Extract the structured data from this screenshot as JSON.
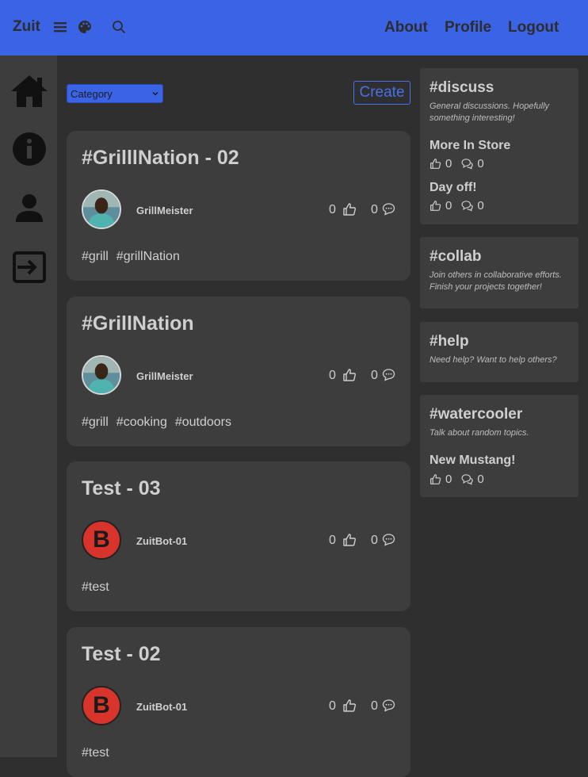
{
  "header": {
    "brand": "Zuit",
    "icons": [
      "menu-icon",
      "palette-icon",
      "search-icon"
    ],
    "nav": {
      "about": "About",
      "profile": "Profile",
      "logout": "Logout"
    },
    "accent": "#3b63e6"
  },
  "sidebar": {
    "icons": [
      "home-icon",
      "info-icon",
      "user-icon",
      "logout-icon"
    ]
  },
  "toolbar": {
    "category_value": "Category",
    "create_label": "Create"
  },
  "posts": [
    {
      "title": "#GrilllNation - 02",
      "author": "GrillMeister",
      "likes": "0",
      "comments": "0",
      "tags": [
        "#grill",
        "#grillNation"
      ]
    },
    {
      "title": "#GrillNation",
      "author": "GrillMeister",
      "likes": "0",
      "comments": "0",
      "tags": [
        "#grill",
        "#cooking",
        "#outdoors"
      ]
    },
    {
      "title": "Test - 03",
      "author": "ZuitBot-01",
      "avatar_letter": "B",
      "likes": "0",
      "comments": "0",
      "tags": [
        "#test"
      ]
    },
    {
      "title": "Test - 02",
      "author": "ZuitBot-01",
      "avatar_letter": "B",
      "likes": "0",
      "comments": "0",
      "tags": [
        "#test"
      ]
    }
  ],
  "channels": [
    {
      "name": "#discuss",
      "description": "General discussions. Hopefully something interesting!",
      "posts": [
        {
          "title": "More In Store",
          "likes": "0",
          "comments": "0"
        },
        {
          "title": "Day off!",
          "likes": "0",
          "comments": "0"
        }
      ]
    },
    {
      "name": "#collab",
      "description": "Join others in collaborative efforts. Finish your projects together!",
      "posts": []
    },
    {
      "name": "#help",
      "description": "Need help? Want to help others?",
      "posts": []
    },
    {
      "name": "#watercooler",
      "description": "Talk about random topics.",
      "posts": [
        {
          "title": "New Mustang!",
          "likes": "0",
          "comments": "0"
        }
      ]
    }
  ]
}
